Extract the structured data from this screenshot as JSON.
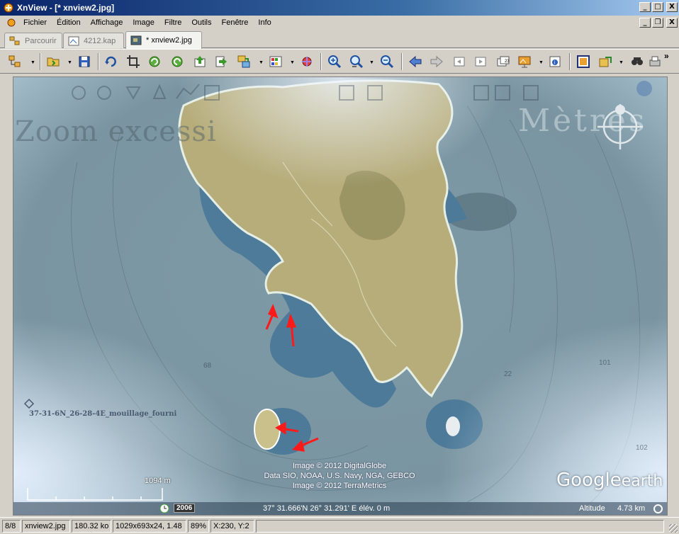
{
  "window": {
    "title": "XnView - [* xnview2.jpg]",
    "controls": {
      "minimize": "_",
      "maximize": "□",
      "close": "X"
    }
  },
  "menubar": {
    "items": [
      "Fichier",
      "Édition",
      "Affichage",
      "Image",
      "Filtre",
      "Outils",
      "Fenêtre",
      "Info"
    ],
    "mdi_controls": {
      "minimize": "_",
      "restore": "❐",
      "close": "X"
    }
  },
  "tabs": [
    {
      "label": "Parcourir",
      "icon": "browser-icon",
      "active": false
    },
    {
      "label": "4212.kap",
      "icon": "image-thumb-icon",
      "active": false
    },
    {
      "label": "* xnview2.jpg",
      "icon": "image-thumb-icon",
      "active": true
    }
  ],
  "toolbar": {
    "items": [
      "browser-tree-icon",
      "open-folder-icon",
      "save-icon",
      "undo-icon",
      "crop-icon",
      "rotate-left-icon",
      "rotate-right-icon",
      "move-up-icon",
      "move-right-icon",
      "convert-icon",
      "palette-icon",
      "effects-icon",
      "zoom-in-icon",
      "zoom-actual-icon",
      "zoom-out-icon",
      "previous-icon",
      "next-icon",
      "first-page-icon",
      "last-page-icon",
      "pages-icon",
      "slideshow-icon",
      "properties-icon",
      "fullscreen-icon",
      "export-icon",
      "search-icon",
      "print-icon"
    ],
    "overflow": "»"
  },
  "map": {
    "watermark_left": "Zoom excessi",
    "watermark_right": "Mètres",
    "placemark_label": "37-31-6N_26-28-4E_mouillage_fourni",
    "copyright_lines": [
      "Image © 2012 DigitalGlobe",
      "Data SIO, NOAA, U.S. Navy, NGA, GEBCO",
      "Image © 2012 TerraMetrics"
    ],
    "scale_label": "1094  m",
    "logo_main": "Google",
    "logo_sub": "earth",
    "depths": [
      "68",
      "22",
      "101",
      "102"
    ],
    "status": {
      "year": "2006",
      "coords": "37° 31.666'N   26° 31.291' E  élév.      0 m",
      "altitude_label": "Altitude",
      "altitude_value": "4.73 km"
    },
    "colors": {
      "land": "#b9b17a",
      "shallow": "#3d6f95",
      "sea": "#7f98a3",
      "arrow": "#ff1a1a"
    }
  },
  "statusbar": {
    "index": "8/8",
    "filename": "xnview2.jpg",
    "filesize": "180.32 ko",
    "dimensions": "1029x693x24, 1.48",
    "zoom": "89%",
    "cursor": "X:230, Y:2"
  }
}
